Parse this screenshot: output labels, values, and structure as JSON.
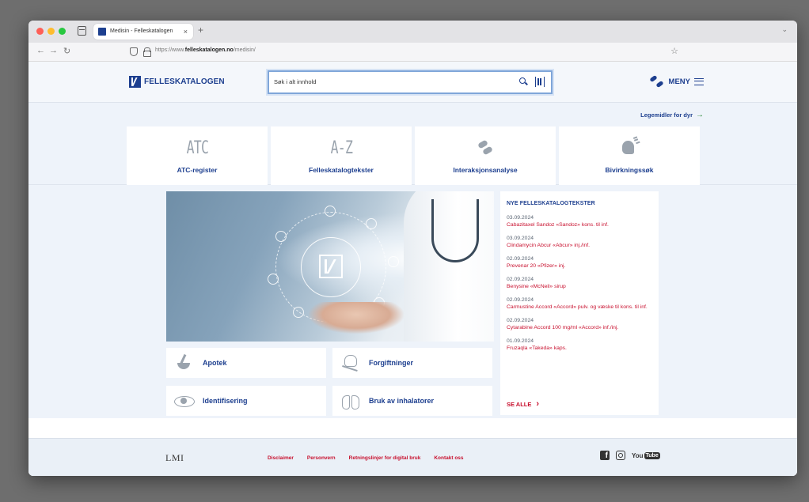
{
  "browser": {
    "tab_title": "Medisin - Felleskatalogen",
    "tab_close": "×",
    "new_tab": "+",
    "url_prefix": "https://www.",
    "url_host": "felleskatalogen.no",
    "url_path": "/medisin/"
  },
  "header": {
    "logo_text": "FELLESKATALOGEN",
    "search_value": "Søk i alt innhold",
    "menu_label": "MENY"
  },
  "subbar": {
    "animal_link": "Legemidler for dyr"
  },
  "tiles": [
    {
      "glyph": "ATC",
      "label": "ATC-register"
    },
    {
      "glyph": "A-Z",
      "label": "Felleskatalogtekster"
    },
    {
      "label": "Interaksjonsanalyse"
    },
    {
      "label": "Bivirkningssøk"
    }
  ],
  "links": {
    "apotek": "Apotek",
    "forgiftninger": "Forgiftninger",
    "identifisering": "Identifisering",
    "inhalatorer": "Bruk av inhalatorer"
  },
  "news": {
    "title": "NYE FELLESKATALOGTEKSTER",
    "items": [
      {
        "date": "03.09.2024",
        "text": "Cabazitaxel Sandoz «Sandoz» kons. til inf."
      },
      {
        "date": "03.09.2024",
        "text": "Clindamycin Abcur «Abcur» inj./inf."
      },
      {
        "date": "02.09.2024",
        "text": "Prevenar 20 «Pfizer» inj."
      },
      {
        "date": "02.09.2024",
        "text": "Benysine «McNeil» sirup"
      },
      {
        "date": "02.09.2024",
        "text": "Carmustine Accord «Accord» pulv. og væske til kons. til inf."
      },
      {
        "date": "02.09.2024",
        "text": "Cytarabine Accord 100 mg/ml «Accord» inf./inj."
      },
      {
        "date": "01.09.2024",
        "text": "Fruzaqla «Takeda» kaps."
      }
    ],
    "see_all": "SE ALLE"
  },
  "footer": {
    "brand": "LMI",
    "links": [
      "Disclaimer",
      "Personvern",
      "Retningslinjer for digital bruk",
      "Kontakt oss"
    ],
    "youtube_you": "You",
    "youtube_tube": "Tube"
  },
  "colors": {
    "brand_blue": "#1d3f8f",
    "accent_red": "#c8102e",
    "arrow_green": "#2e8b3a"
  }
}
